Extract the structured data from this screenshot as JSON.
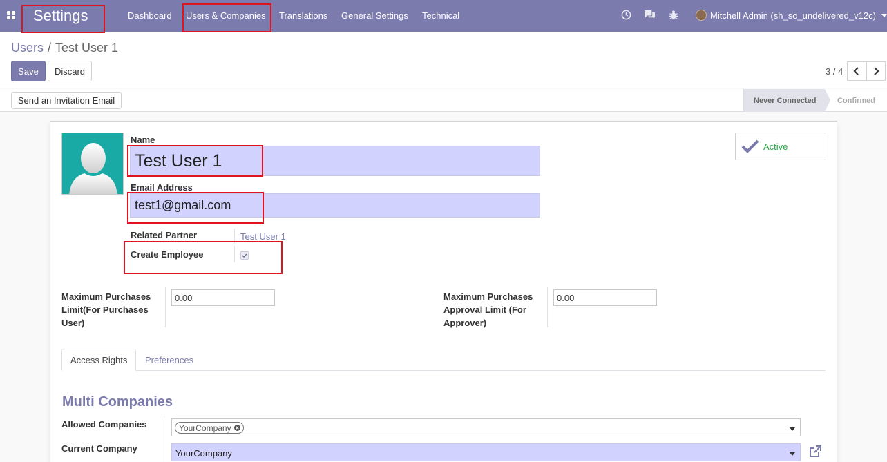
{
  "navbar": {
    "brand": "Settings",
    "menu": [
      "Dashboard",
      "Users & Companies",
      "Translations",
      "General Settings",
      "Technical"
    ],
    "user": "Mitchell Admin (sh_so_undelivered_v12c)",
    "icons": [
      "activity-clock-icon",
      "discuss-chat-icon",
      "debug-bug-icon"
    ]
  },
  "breadcrumb": {
    "parent": "Users",
    "separator": "/",
    "current": "Test User 1"
  },
  "actions": {
    "save": "Save",
    "discard": "Discard"
  },
  "pager": {
    "value": "3 / 4",
    "prev": "‹",
    "next": "›"
  },
  "statusbar": {
    "button": "Send an Invitation Email",
    "stages": [
      "Never Connected",
      "Confirmed"
    ],
    "current_stage": "Never Connected"
  },
  "form": {
    "name_label": "Name",
    "name_value": "Test User 1",
    "email_label": "Email Address",
    "email_value": "test1@gmail.com",
    "partner_label": "Related Partner",
    "partner_value": "Test User 1",
    "employee_label": "Create Employee",
    "employee_checked": true,
    "purchase_limit_label": "Maximum Purchases Limit(For Purchases User)",
    "purchase_limit_value": "0.00",
    "approval_limit_label": "Maximum Purchases Approval Limit (For Approver)",
    "approval_limit_value": "0.00",
    "active_label": "Active"
  },
  "tabs": [
    "Access Rights",
    "Preferences"
  ],
  "active_tab": "Access Rights",
  "multi_companies": {
    "title": "Multi Companies",
    "allowed_label": "Allowed Companies",
    "allowed_tags": [
      "YourCompany"
    ],
    "current_label": "Current Company",
    "current_value": "YourCompany"
  },
  "colors": {
    "brand": "#7c7bad",
    "highlight": "#e0141e",
    "active_green": "#28a745",
    "input_fill": "#d2d2ff"
  }
}
